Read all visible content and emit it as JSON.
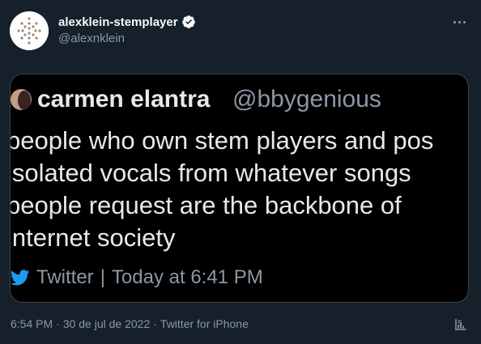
{
  "author": {
    "display_name": "alexklein-stemplayer",
    "handle": "@alexnklein",
    "verified": true
  },
  "icons": {
    "more": "more-icon",
    "verified": "verified-badge-icon",
    "twitter": "twitter-bird-icon",
    "analytics": "analytics-icon"
  },
  "media": {
    "quoted_name": "carmen elantra",
    "quoted_handle": "@bbygenious",
    "text_lines": [
      "people who own stem players and pos",
      "isolated vocals from whatever songs",
      "people request are the backbone of",
      "internet society"
    ],
    "source": "Twitter",
    "divider": "|",
    "time": "Today at 6:41 PM"
  },
  "meta": {
    "time": "6:54 PM",
    "dot1": "·",
    "date": "30 de jul de 2022",
    "dot2": "·",
    "source": "Twitter for iPhone"
  },
  "colors": {
    "background": "#15202b",
    "card_background": "#000000",
    "primary_text": "#f7f9f9",
    "secondary_text": "#8b98a5",
    "accent": "#1d9bf0"
  }
}
